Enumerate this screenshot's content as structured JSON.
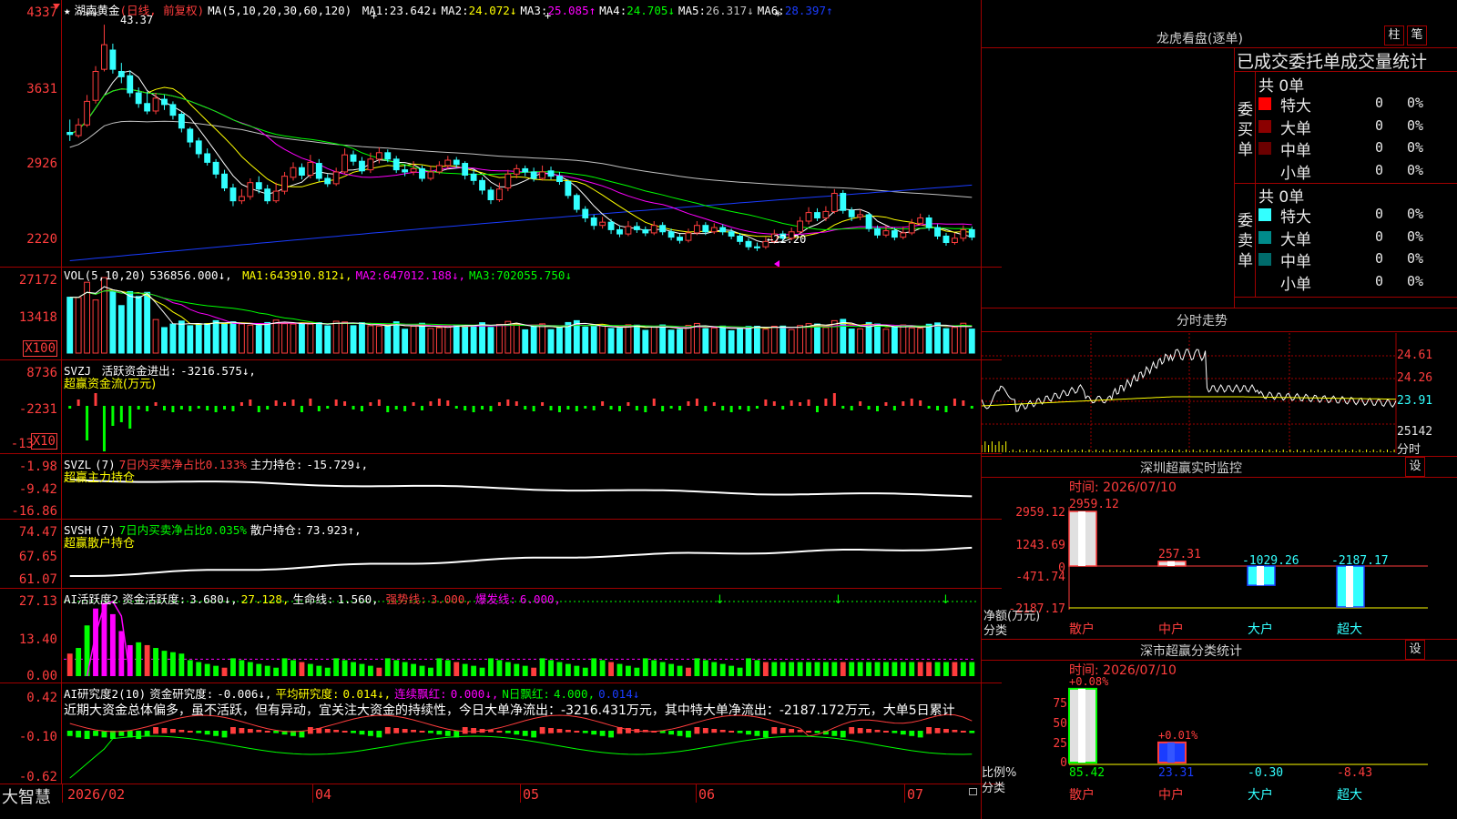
{
  "colors": {
    "up": "#ff3d3d",
    "down": "#33ffff",
    "grid": "#a00000",
    "ma1": "#ffffff",
    "ma2": "#ffff00",
    "ma3": "#ff00ff",
    "ma4": "#00ff00",
    "ma5": "#c0c0c0",
    "ma6": "#1a3cff",
    "green": "#00ff00"
  },
  "main_panel": {
    "star": "★",
    "stock_name": "湖南黄金",
    "period": "(日线, 前复权)",
    "ma_params": "MA(5,10,20,30,60,120)",
    "ma": [
      {
        "label": "MA1:",
        "value": "23.642↓",
        "color": "#ffffff"
      },
      {
        "label": "MA2:",
        "value": "24.072↓",
        "color": "#ffff00"
      },
      {
        "label": "MA3:",
        "value": "25.085↑",
        "color": "#ff00ff"
      },
      {
        "label": "MA4:",
        "value": "24.705↓",
        "color": "#00ff00"
      },
      {
        "label": "MA5:",
        "value": "26.317↓",
        "color": "#c0c0c0"
      },
      {
        "label": "MA6:",
        "value": "28.397↑",
        "color": "#1a3cff"
      }
    ],
    "y_ticks": [
      "4337",
      "3631",
      "2926",
      "2220"
    ],
    "high_label": "43.37",
    "low_label": "←22.20",
    "markers": [
      "**",
      "+",
      "+",
      "*"
    ]
  },
  "chart_data": {
    "type": "candlestick",
    "price_candles": [
      [
        33.3,
        33.1,
        34.5,
        32.5
      ],
      [
        33.0,
        34.0,
        34.6,
        32.8
      ],
      [
        34.0,
        36.2,
        36.8,
        33.8
      ],
      [
        36.3,
        39.0,
        39.5,
        36.0
      ],
      [
        39.2,
        41.5,
        43.37,
        39.0
      ],
      [
        41.0,
        39.2,
        41.6,
        38.8
      ],
      [
        39.0,
        38.5,
        39.8,
        37.9
      ],
      [
        38.6,
        37.0,
        39.1,
        36.6
      ],
      [
        37.0,
        36.0,
        37.5,
        35.6
      ],
      [
        36.0,
        35.3,
        37.1,
        35.0
      ],
      [
        35.3,
        36.5,
        37.0,
        35.0
      ],
      [
        36.4,
        35.9,
        36.8,
        35.4
      ],
      [
        35.9,
        34.9,
        36.2,
        34.5
      ],
      [
        35.0,
        33.7,
        35.2,
        33.3
      ],
      [
        33.6,
        32.4,
        33.8,
        31.9
      ],
      [
        32.5,
        31.3,
        32.8,
        30.9
      ],
      [
        31.3,
        30.5,
        31.8,
        30.2
      ],
      [
        30.5,
        29.4,
        30.8,
        29.0
      ],
      [
        29.4,
        28.1,
        29.8,
        27.8
      ],
      [
        28.1,
        26.9,
        28.5,
        26.4
      ],
      [
        26.9,
        27.3,
        28.0,
        26.6
      ],
      [
        27.3,
        28.6,
        29.0,
        27.0
      ],
      [
        28.6,
        28.0,
        29.2,
        27.6
      ],
      [
        28.0,
        26.9,
        28.4,
        26.6
      ],
      [
        26.9,
        27.8,
        28.6,
        26.7
      ],
      [
        27.8,
        29.2,
        29.6,
        27.5
      ],
      [
        29.1,
        30.0,
        30.5,
        28.8
      ],
      [
        30.0,
        29.3,
        30.4,
        28.9
      ],
      [
        29.3,
        30.5,
        31.2,
        29.0
      ],
      [
        30.4,
        29.0,
        30.8,
        28.7
      ],
      [
        29.0,
        28.5,
        29.4,
        28.2
      ],
      [
        28.5,
        29.6,
        30.0,
        28.3
      ],
      [
        29.6,
        31.2,
        31.8,
        29.4
      ],
      [
        31.2,
        30.6,
        31.6,
        30.2
      ],
      [
        30.6,
        29.7,
        31.0,
        29.4
      ],
      [
        29.8,
        30.8,
        31.4,
        29.5
      ],
      [
        30.8,
        31.4,
        31.9,
        30.4
      ],
      [
        31.4,
        30.8,
        31.7,
        30.5
      ],
      [
        30.8,
        29.8,
        31.1,
        29.5
      ],
      [
        29.8,
        29.6,
        30.3,
        29.2
      ],
      [
        29.6,
        29.9,
        30.6,
        29.3
      ],
      [
        29.9,
        29.0,
        30.2,
        28.7
      ],
      [
        29.0,
        29.6,
        30.2,
        28.8
      ],
      [
        29.6,
        30.2,
        30.6,
        29.4
      ],
      [
        30.2,
        30.7,
        31.1,
        29.9
      ],
      [
        30.7,
        30.3,
        31.0,
        30.0
      ],
      [
        30.4,
        29.3,
        30.6,
        28.9
      ],
      [
        29.4,
        28.8,
        29.8,
        28.4
      ],
      [
        28.8,
        27.9,
        29.1,
        27.5
      ],
      [
        27.9,
        27.0,
        28.2,
        26.6
      ],
      [
        27.0,
        28.0,
        28.6,
        26.8
      ],
      [
        28.1,
        29.4,
        29.8,
        27.8
      ],
      [
        29.4,
        29.9,
        30.3,
        29.0
      ],
      [
        29.9,
        29.6,
        30.2,
        29.2
      ],
      [
        29.6,
        29.0,
        30.0,
        28.7
      ],
      [
        29.0,
        29.6,
        30.2,
        28.8
      ],
      [
        29.7,
        29.2,
        30.1,
        28.9
      ],
      [
        29.2,
        28.7,
        29.6,
        28.4
      ],
      [
        28.7,
        27.4,
        28.9,
        27.1
      ],
      [
        27.4,
        26.1,
        27.6,
        25.8
      ],
      [
        26.1,
        25.3,
        26.4,
        24.9
      ],
      [
        25.3,
        24.6,
        25.6,
        24.2
      ],
      [
        24.6,
        24.9,
        25.4,
        24.3
      ],
      [
        24.9,
        24.2,
        25.2,
        23.8
      ],
      [
        24.2,
        23.8,
        24.6,
        23.5
      ],
      [
        23.8,
        24.5,
        25.0,
        23.6
      ],
      [
        24.5,
        24.2,
        24.9,
        23.9
      ],
      [
        24.2,
        23.9,
        24.5,
        23.6
      ],
      [
        23.9,
        24.6,
        25.0,
        23.7
      ],
      [
        24.6,
        24.0,
        24.9,
        23.7
      ],
      [
        24.0,
        23.5,
        24.3,
        23.2
      ],
      [
        23.5,
        23.2,
        23.8,
        22.9
      ],
      [
        23.2,
        23.9,
        24.3,
        23.0
      ],
      [
        23.9,
        24.6,
        25.0,
        23.7
      ],
      [
        24.6,
        24.0,
        24.9,
        23.7
      ],
      [
        24.0,
        24.4,
        24.8,
        23.8
      ],
      [
        24.4,
        24.0,
        24.7,
        23.7
      ],
      [
        24.0,
        23.6,
        24.3,
        23.3
      ],
      [
        23.6,
        23.1,
        23.9,
        22.8
      ],
      [
        23.1,
        22.6,
        23.4,
        22.3
      ],
      [
        22.6,
        22.5,
        23.0,
        22.2
      ],
      [
        22.6,
        23.1,
        23.5,
        22.4
      ],
      [
        23.1,
        23.8,
        24.2,
        22.9
      ],
      [
        23.8,
        23.4,
        24.1,
        23.1
      ],
      [
        23.4,
        24.0,
        24.4,
        23.2
      ],
      [
        24.0,
        25.0,
        25.4,
        23.8
      ],
      [
        25.0,
        25.8,
        26.3,
        24.7
      ],
      [
        25.8,
        25.3,
        26.2,
        25.0
      ],
      [
        25.3,
        25.9,
        26.4,
        25.0
      ],
      [
        25.9,
        27.6,
        28.0,
        25.7
      ],
      [
        27.6,
        26.0,
        27.9,
        25.7
      ],
      [
        26.0,
        25.4,
        26.3,
        25.0
      ],
      [
        25.4,
        25.6,
        26.1,
        25.1
      ],
      [
        25.6,
        24.3,
        25.8,
        24.0
      ],
      [
        24.3,
        23.7,
        24.6,
        23.4
      ],
      [
        23.7,
        24.1,
        24.6,
        23.5
      ],
      [
        24.1,
        23.5,
        24.4,
        23.2
      ],
      [
        23.5,
        23.9,
        24.5,
        23.3
      ],
      [
        23.9,
        24.8,
        25.2,
        23.7
      ],
      [
        24.8,
        25.3,
        25.7,
        24.6
      ],
      [
        25.3,
        24.4,
        25.6,
        24.1
      ],
      [
        24.4,
        23.6,
        24.7,
        23.3
      ],
      [
        23.6,
        23.0,
        23.9,
        22.7
      ],
      [
        23.0,
        23.4,
        23.9,
        22.8
      ],
      [
        23.4,
        24.2,
        24.6,
        23.1
      ],
      [
        24.2,
        23.5,
        24.5,
        23.2
      ]
    ],
    "x_ticks": [
      "2026/02",
      "04",
      "05",
      "06",
      "07"
    ]
  },
  "vol_panel": {
    "title": "VOL(5,10,20)",
    "value": "536856.000↓,",
    "ma": [
      {
        "label": "MA1:",
        "value": "643910.812↓,",
        "color": "#ffff00"
      },
      {
        "label": "MA2:",
        "value": "647012.188↓,",
        "color": "#ff00ff"
      },
      {
        "label": "MA3:",
        "value": "702055.750↓",
        "color": "#00ff00"
      }
    ],
    "y_ticks": [
      "27172",
      "13418"
    ],
    "unit": "X100"
  },
  "svzj_panel": {
    "title": "SVZJ",
    "label": "活跃资金进出:",
    "value": "-3216.575↓,",
    "sub": "超赢资金流(万元)",
    "y_ticks": [
      "8736",
      "-2231",
      "-13"
    ],
    "unit": "X10"
  },
  "svzl_panel": {
    "title": "SVZL",
    "param": "(7)",
    "ratio": "7日内买卖净占比0.133%",
    "label": "主力持仓:",
    "value": "-15.729↓,",
    "sub": "超赢主力持仓",
    "y_ticks": [
      "-1.98",
      "-9.42",
      "-16.86"
    ]
  },
  "svsh_panel": {
    "title": "SVSH",
    "param": "(7)",
    "ratio": "7日内买卖净占比0.035%",
    "label": "散户持仓:",
    "value": "73.923↑,",
    "sub": "超赢散户持仓",
    "y_ticks": [
      "74.47",
      "67.65",
      "61.07"
    ]
  },
  "ai_active_panel": {
    "title": "AI活跃度2",
    "label": "资金活跃度:",
    "value": "3.680↓,",
    "v2": "27.128,",
    "life_label": "生命线:",
    "life_value": "1.560,",
    "strong_label": "强势线:",
    "strong_value": "3.000,",
    "burst_label": "爆发线:",
    "burst_value": "6.000,",
    "y_ticks": [
      "27.13",
      "13.40",
      "0.00"
    ]
  },
  "ai_research_panel": {
    "title": "AI研究度2(10)",
    "label": "资金研究度:",
    "value": "-0.006↓,",
    "avg_label": "平均研究度:",
    "avg_value": "0.014↓,",
    "cont_label": "连续飘红:",
    "cont_value": "0.000↓,",
    "n_label": "N日飘红:",
    "n_value": "4.000,",
    "n_value2": "0.014↓",
    "note": "近期大资金总体偏多，虽不活跃，但有异动，宜关注大资金的持续性，今日大单净流出：-3216.431万元，其中特大单净流出：-2187.172万元，大单5日累计",
    "y_ticks": [
      "0.42",
      "-0.10",
      "-0.62"
    ]
  },
  "bottom_bar": {
    "brand": "大智慧",
    "date": "2026/02",
    "months": [
      "04",
      "05",
      "06",
      "07"
    ]
  },
  "dragon_tiger": {
    "title": "龙虎看盘(逐单)",
    "btn_bar": "柱",
    "btn_pen": "笔",
    "table_title": "已成交委托单成交量统计",
    "buy": {
      "group": "委买单",
      "total": "共 0单",
      "rows": [
        {
          "label": "特大",
          "value": "0",
          "pct": "0%",
          "color": "#ff0000"
        },
        {
          "label": "大单",
          "value": "0",
          "pct": "0%",
          "color": "#8b0000"
        },
        {
          "label": "中单",
          "value": "0",
          "pct": "0%",
          "color": "#6b0000"
        },
        {
          "label": "小单",
          "value": "0",
          "pct": "0%",
          "color": ""
        }
      ]
    },
    "sell": {
      "group": "委卖单",
      "total": "共 0单",
      "rows": [
        {
          "label": "特大",
          "value": "0",
          "pct": "0%",
          "color": "#33ffff"
        },
        {
          "label": "大单",
          "value": "0",
          "pct": "0%",
          "color": "#008b8b"
        },
        {
          "label": "中单",
          "value": "0",
          "pct": "0%",
          "color": "#006b6b"
        },
        {
          "label": "小单",
          "value": "0",
          "pct": "0%",
          "color": ""
        }
      ]
    }
  },
  "intraday": {
    "title": "分时走势",
    "y_ticks": [
      "24.61",
      "24.26",
      "23.91",
      "25142",
      "分时"
    ]
  },
  "sz_monitor": {
    "title": "深圳超赢实时监控",
    "btn": "设",
    "time": "时间: 2026/07/10",
    "y_ticks": [
      "2959.12",
      "1243.69",
      "0",
      "-471.74",
      "-2187.17"
    ],
    "y_axis_label": "净额(万元)",
    "x_axis_label": "分类",
    "bars": [
      {
        "label": "散户",
        "value": 2959.12,
        "text": "2959.12"
      },
      {
        "label": "中户",
        "value": 257.31,
        "text": "257.31"
      },
      {
        "label": "大户",
        "value": -1029.26,
        "text": "-1029.26"
      },
      {
        "label": "超大",
        "value": -2187.17,
        "text": "-2187.17"
      }
    ]
  },
  "sz_class": {
    "title": "深市超赢分类统计",
    "btn": "设",
    "time": "时间: 2026/07/10",
    "y_ticks": [
      "75",
      "50",
      "25",
      "0"
    ],
    "y_axis_label": "比例%",
    "x_axis_label": "分类",
    "bars": [
      {
        "label": "散户",
        "value": 85.42,
        "top": "+0.08%"
      },
      {
        "label": "中户",
        "value": 23.31,
        "top": "+0.01%"
      },
      {
        "label": "大户",
        "value": -0.3,
        "top": ""
      },
      {
        "label": "超大",
        "value": -8.43,
        "top": ""
      }
    ]
  }
}
